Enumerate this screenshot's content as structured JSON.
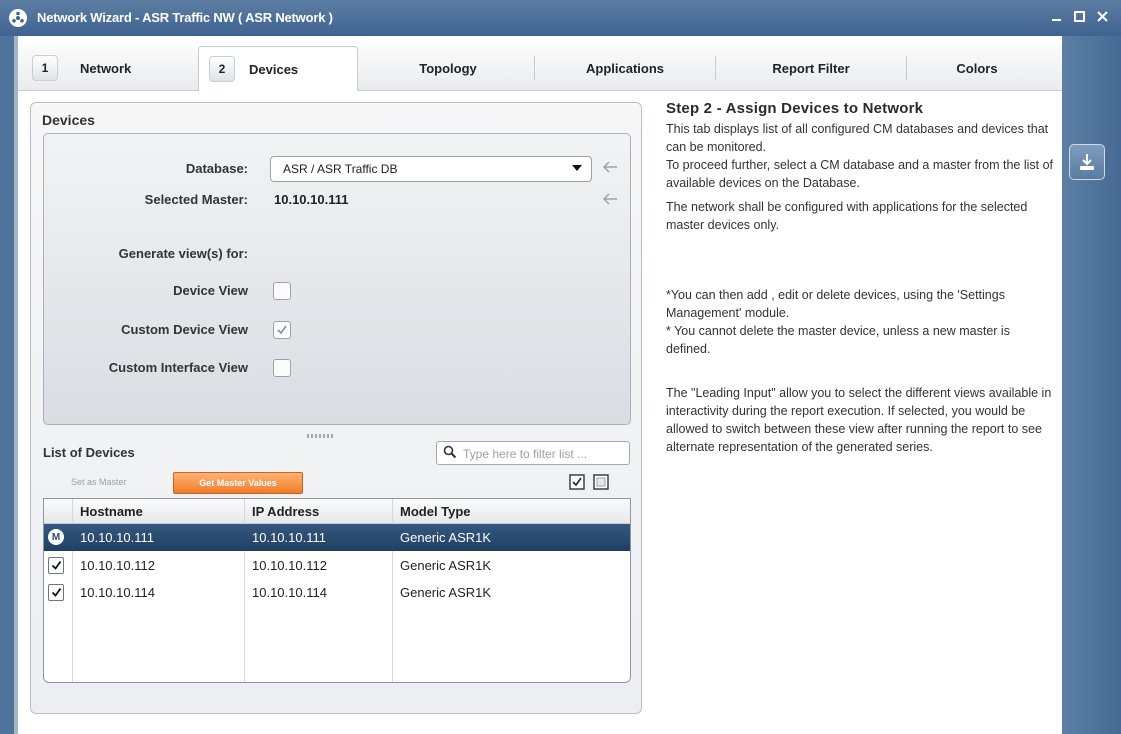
{
  "window": {
    "title": "Network Wizard - ASR Traffic NW ( ASR Network )"
  },
  "tabs": [
    {
      "num": "1",
      "label": "Network"
    },
    {
      "num": "2",
      "label": "Devices"
    },
    {
      "num": "",
      "label": "Topology"
    },
    {
      "num": "",
      "label": "Applications"
    },
    {
      "num": "",
      "label": "Report Filter"
    },
    {
      "num": "",
      "label": "Colors"
    }
  ],
  "devices_panel": {
    "title": "Devices",
    "database_label": "Database:",
    "database_value": "ASR / ASR Traffic DB",
    "selected_master_label": "Selected Master:",
    "selected_master_value": "10.10.10.111",
    "generate_label": "Generate view(s) for:",
    "views": [
      {
        "label": "Device View",
        "checked": false
      },
      {
        "label": "Custom Device View",
        "checked": true
      },
      {
        "label": "Custom Interface View",
        "checked": false
      }
    ]
  },
  "device_list": {
    "title": "List of Devices",
    "filter_placeholder": "Type here to filter list ...",
    "set_master_label": "Set as Master",
    "get_master_values_label": "Get Master Values",
    "columns": [
      "Hostname",
      "IP Address",
      "Model Type"
    ],
    "rows": [
      {
        "hostname": "10.10.10.111",
        "ip": "10.10.10.111",
        "model": "Generic ASR1K",
        "master": true,
        "selected": true
      },
      {
        "hostname": "10.10.10.112",
        "ip": "10.10.10.112",
        "model": "Generic ASR1K",
        "master": false,
        "selected": false
      },
      {
        "hostname": "10.10.10.114",
        "ip": "10.10.10.114",
        "model": "Generic ASR1K",
        "master": false,
        "selected": false
      }
    ],
    "master_badge": "M"
  },
  "help": {
    "heading": "Step 2 - Assign Devices to Network",
    "p1": "This tab displays list of all configured CM databases and devices that can be monitored.",
    "p2": "To proceed further, select a CM database and a master from the list of available devices on the Database.",
    "p3": "The network shall be configured with applications for the selected master devices only.",
    "p4": "*You can then add , edit or delete devices, using the 'Settings Management' module.",
    "p5": "* You cannot delete the master device, unless a new master is defined.",
    "p6": "The \"Leading Input\" allow you to select the different views available in interactivity during the report execution. If selected, you would be allowed to switch between these view after running the report to see alternate representation of the generated series."
  },
  "colors": {
    "titlebar": "#4a6d96",
    "accent_orange": "#f07c2a",
    "selected_row": "#2a4a70"
  }
}
